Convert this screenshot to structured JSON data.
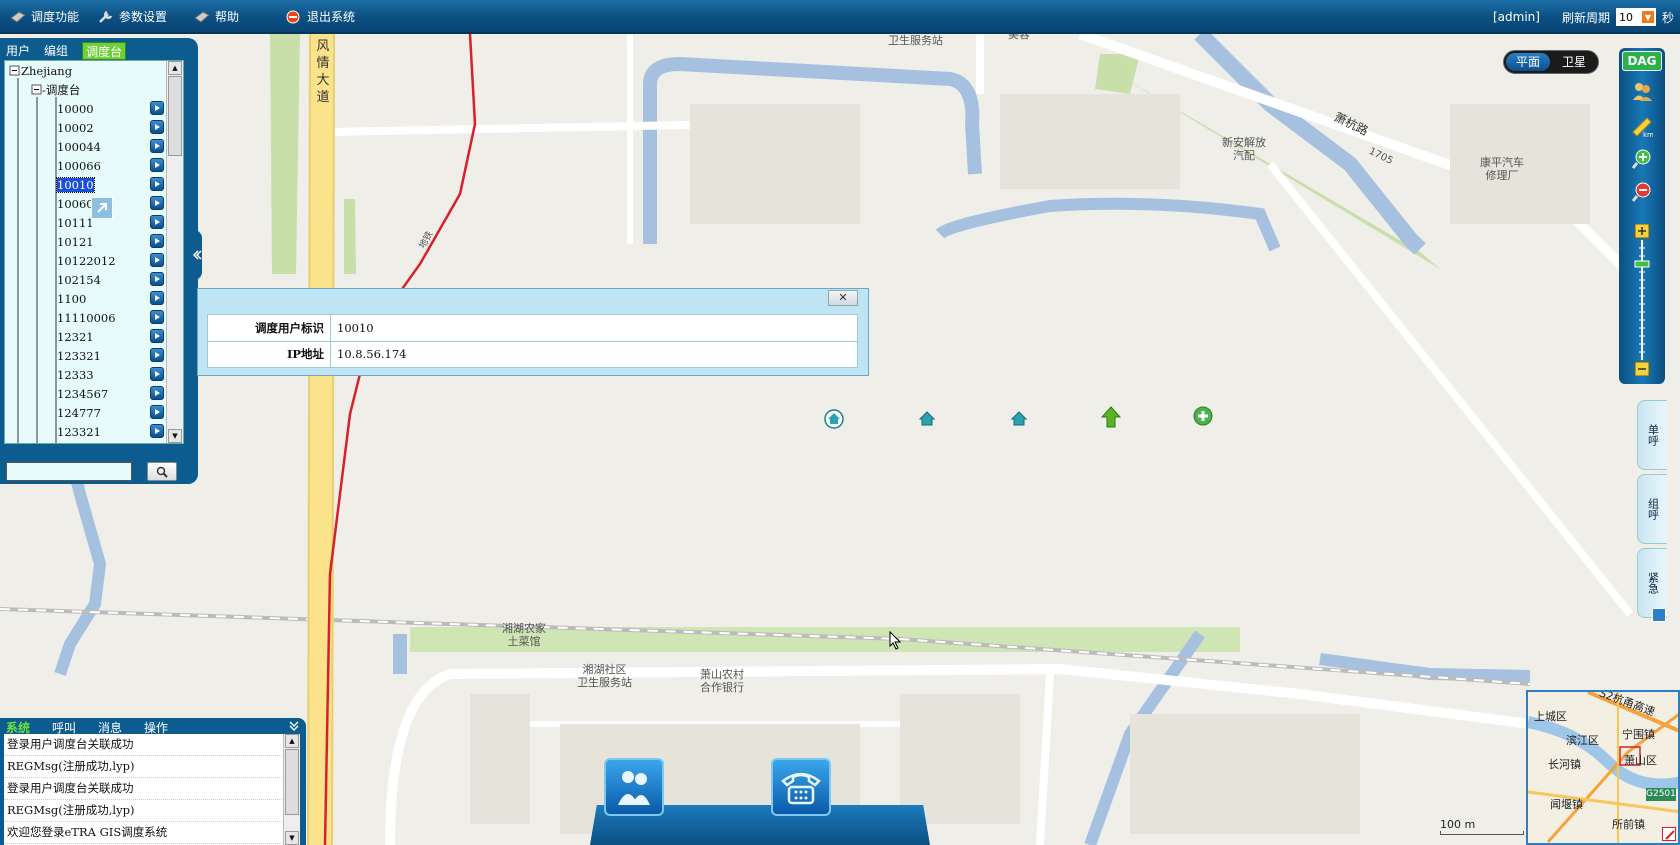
{
  "topbar": {
    "menus": [
      {
        "label": "调度功能",
        "icon": "dispatch-icon"
      },
      {
        "label": "参数设置",
        "icon": "wrench-icon"
      },
      {
        "label": "帮助",
        "icon": "help-icon"
      },
      {
        "label": "退出系统",
        "icon": "exit-icon"
      }
    ],
    "user": "[admin]",
    "refresh_label": "刷新周期",
    "refresh_value": "10",
    "refresh_unit": "秒"
  },
  "left_panel": {
    "tabs": [
      {
        "label": "用户",
        "active": false
      },
      {
        "label": "编组",
        "active": false
      },
      {
        "label": "调度台",
        "active": true
      }
    ],
    "tree": {
      "root": "Zhejiang",
      "group": "调度台",
      "items": [
        "10000",
        "10002",
        "100044",
        "100066",
        "10010",
        "10060",
        "10111",
        "10121",
        "10122012",
        "102154",
        "1100",
        "11110006",
        "12321",
        "123321",
        "12333",
        "1234567",
        "124777",
        "123321"
      ],
      "selected": "10010"
    },
    "search_placeholder": ""
  },
  "popup": {
    "rows": [
      {
        "key": "调度用户标识",
        "value": "10010"
      },
      {
        "key": "IP地址",
        "value": "10.8.56.174"
      }
    ],
    "close_label": "✕"
  },
  "log_panel": {
    "tabs": [
      {
        "label": "系统",
        "active": true
      },
      {
        "label": "呼叫",
        "active": false
      },
      {
        "label": "消息",
        "active": false
      },
      {
        "label": "操作",
        "active": false
      }
    ],
    "lines": [
      "登录用户调度台关联成功",
      "REGMsg(注册成功,lyp)",
      "登录用户调度台关联成功",
      "REGMsg(注册成功,lyp)",
      "欢迎您登录eTRA GIS调度系统"
    ]
  },
  "map_toggle": {
    "options": [
      "平面",
      "卫星"
    ],
    "active": "平面"
  },
  "right_toolbar": {
    "dag_label": "DAG"
  },
  "right_tabs": [
    "单呼",
    "组呼",
    "紧急"
  ],
  "map_labels": {
    "road_fengqing": "风情大道",
    "road_xiaohang": "萧杭路",
    "num_1705": "1705",
    "top_clinic": "卫生服务站",
    "top_misc": "美容",
    "repair1": "新安解放\n汽配",
    "repair2": "康平汽车\n修理厂",
    "restaurant": "湘湖农家\n土菜馆",
    "clinic": "湘湖社区\n卫生服务站",
    "bank": "萧山农村\n合作银行",
    "metro_vert": "地铁"
  },
  "minimap": {
    "labels": [
      "上城区",
      "滨江区",
      "宁围镇",
      "长河镇",
      "萧山区",
      "闻堰镇",
      "所前镇",
      "G2501",
      "S2杭甬高速"
    ]
  },
  "scale_label": "100 m",
  "colors": {
    "brand": "#0b4f82",
    "accent": "#2bb14a",
    "water": "#a6c1e0",
    "route": "#d8202a",
    "road": "#fbe38c"
  }
}
